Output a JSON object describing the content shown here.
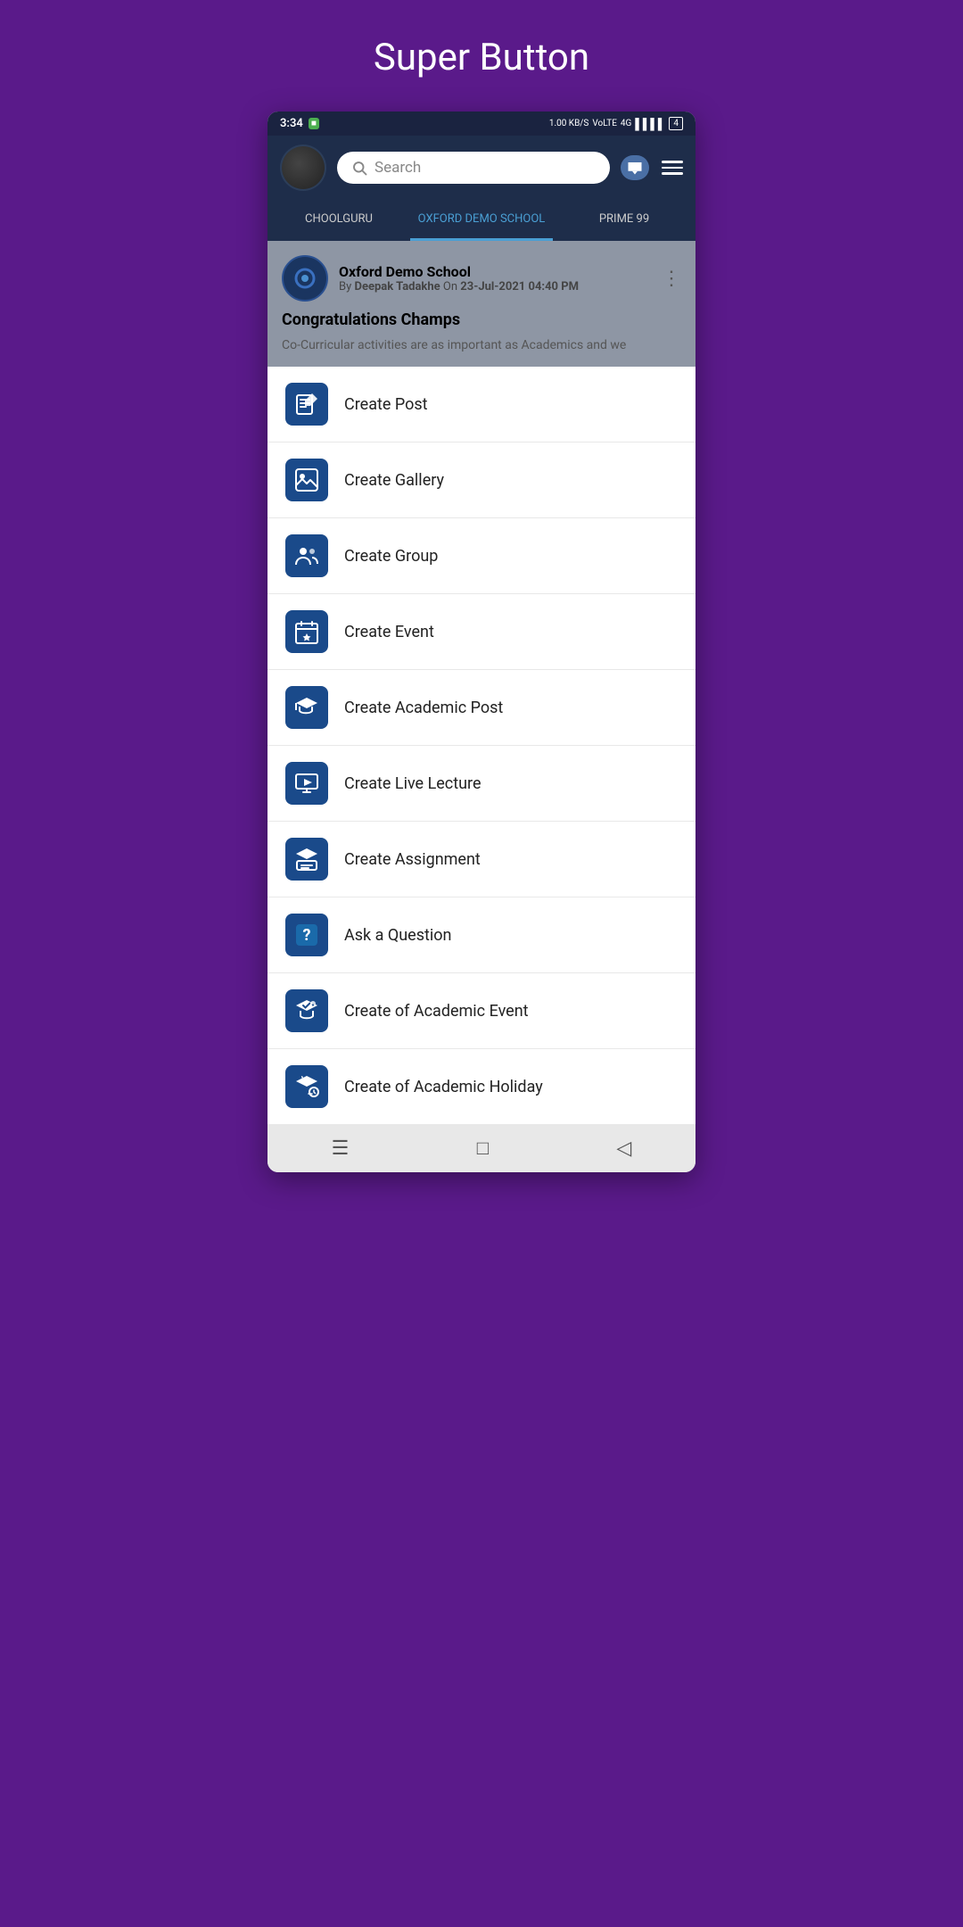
{
  "page": {
    "title": "Super Button"
  },
  "status_bar": {
    "time": "3:34",
    "data": "1.00 KB/S",
    "network": "VoLTE",
    "signal": "4G",
    "battery": "4"
  },
  "header": {
    "search_placeholder": "Search",
    "search_text": "Search"
  },
  "tabs": [
    {
      "label": "CHOOLGURU",
      "active": false
    },
    {
      "label": "OXFORD DEMO SCHOOL",
      "active": true
    },
    {
      "label": "PRIME 99",
      "active": false
    }
  ],
  "post": {
    "school": "Oxford Demo School",
    "by_label": "By",
    "author": "Deepak Tadakhe",
    "on_label": "On",
    "date": "23-Jul-2021 04:40 PM",
    "title": "Congratulations Champs",
    "body": "Co-Curricular activities are as important as Academics and we"
  },
  "menu_items": [
    {
      "id": "create-post",
      "label": "Create Post",
      "icon": "📝"
    },
    {
      "id": "create-gallery",
      "label": "Create Gallery",
      "icon": "🖼"
    },
    {
      "id": "create-group",
      "label": "Create Group",
      "icon": "👥"
    },
    {
      "id": "create-event",
      "label": "Create Event",
      "icon": "📅"
    },
    {
      "id": "create-academic-post",
      "label": "Create Academic Post",
      "icon": "🎓"
    },
    {
      "id": "create-live-lecture",
      "label": "Create Live Lecture",
      "icon": "🖥"
    },
    {
      "id": "create-assignment",
      "label": "Create Assignment",
      "icon": "📚"
    },
    {
      "id": "ask-question",
      "label": "Ask a Question",
      "icon": "❓"
    },
    {
      "id": "create-academic-event",
      "label": "Create of Academic Event",
      "icon": "🎓"
    },
    {
      "id": "create-academic-holiday",
      "label": "Create of Academic Holiday",
      "icon": "🌴"
    }
  ],
  "bottom_nav": {
    "menu_icon": "☰",
    "square_icon": "□",
    "back_icon": "◁"
  }
}
